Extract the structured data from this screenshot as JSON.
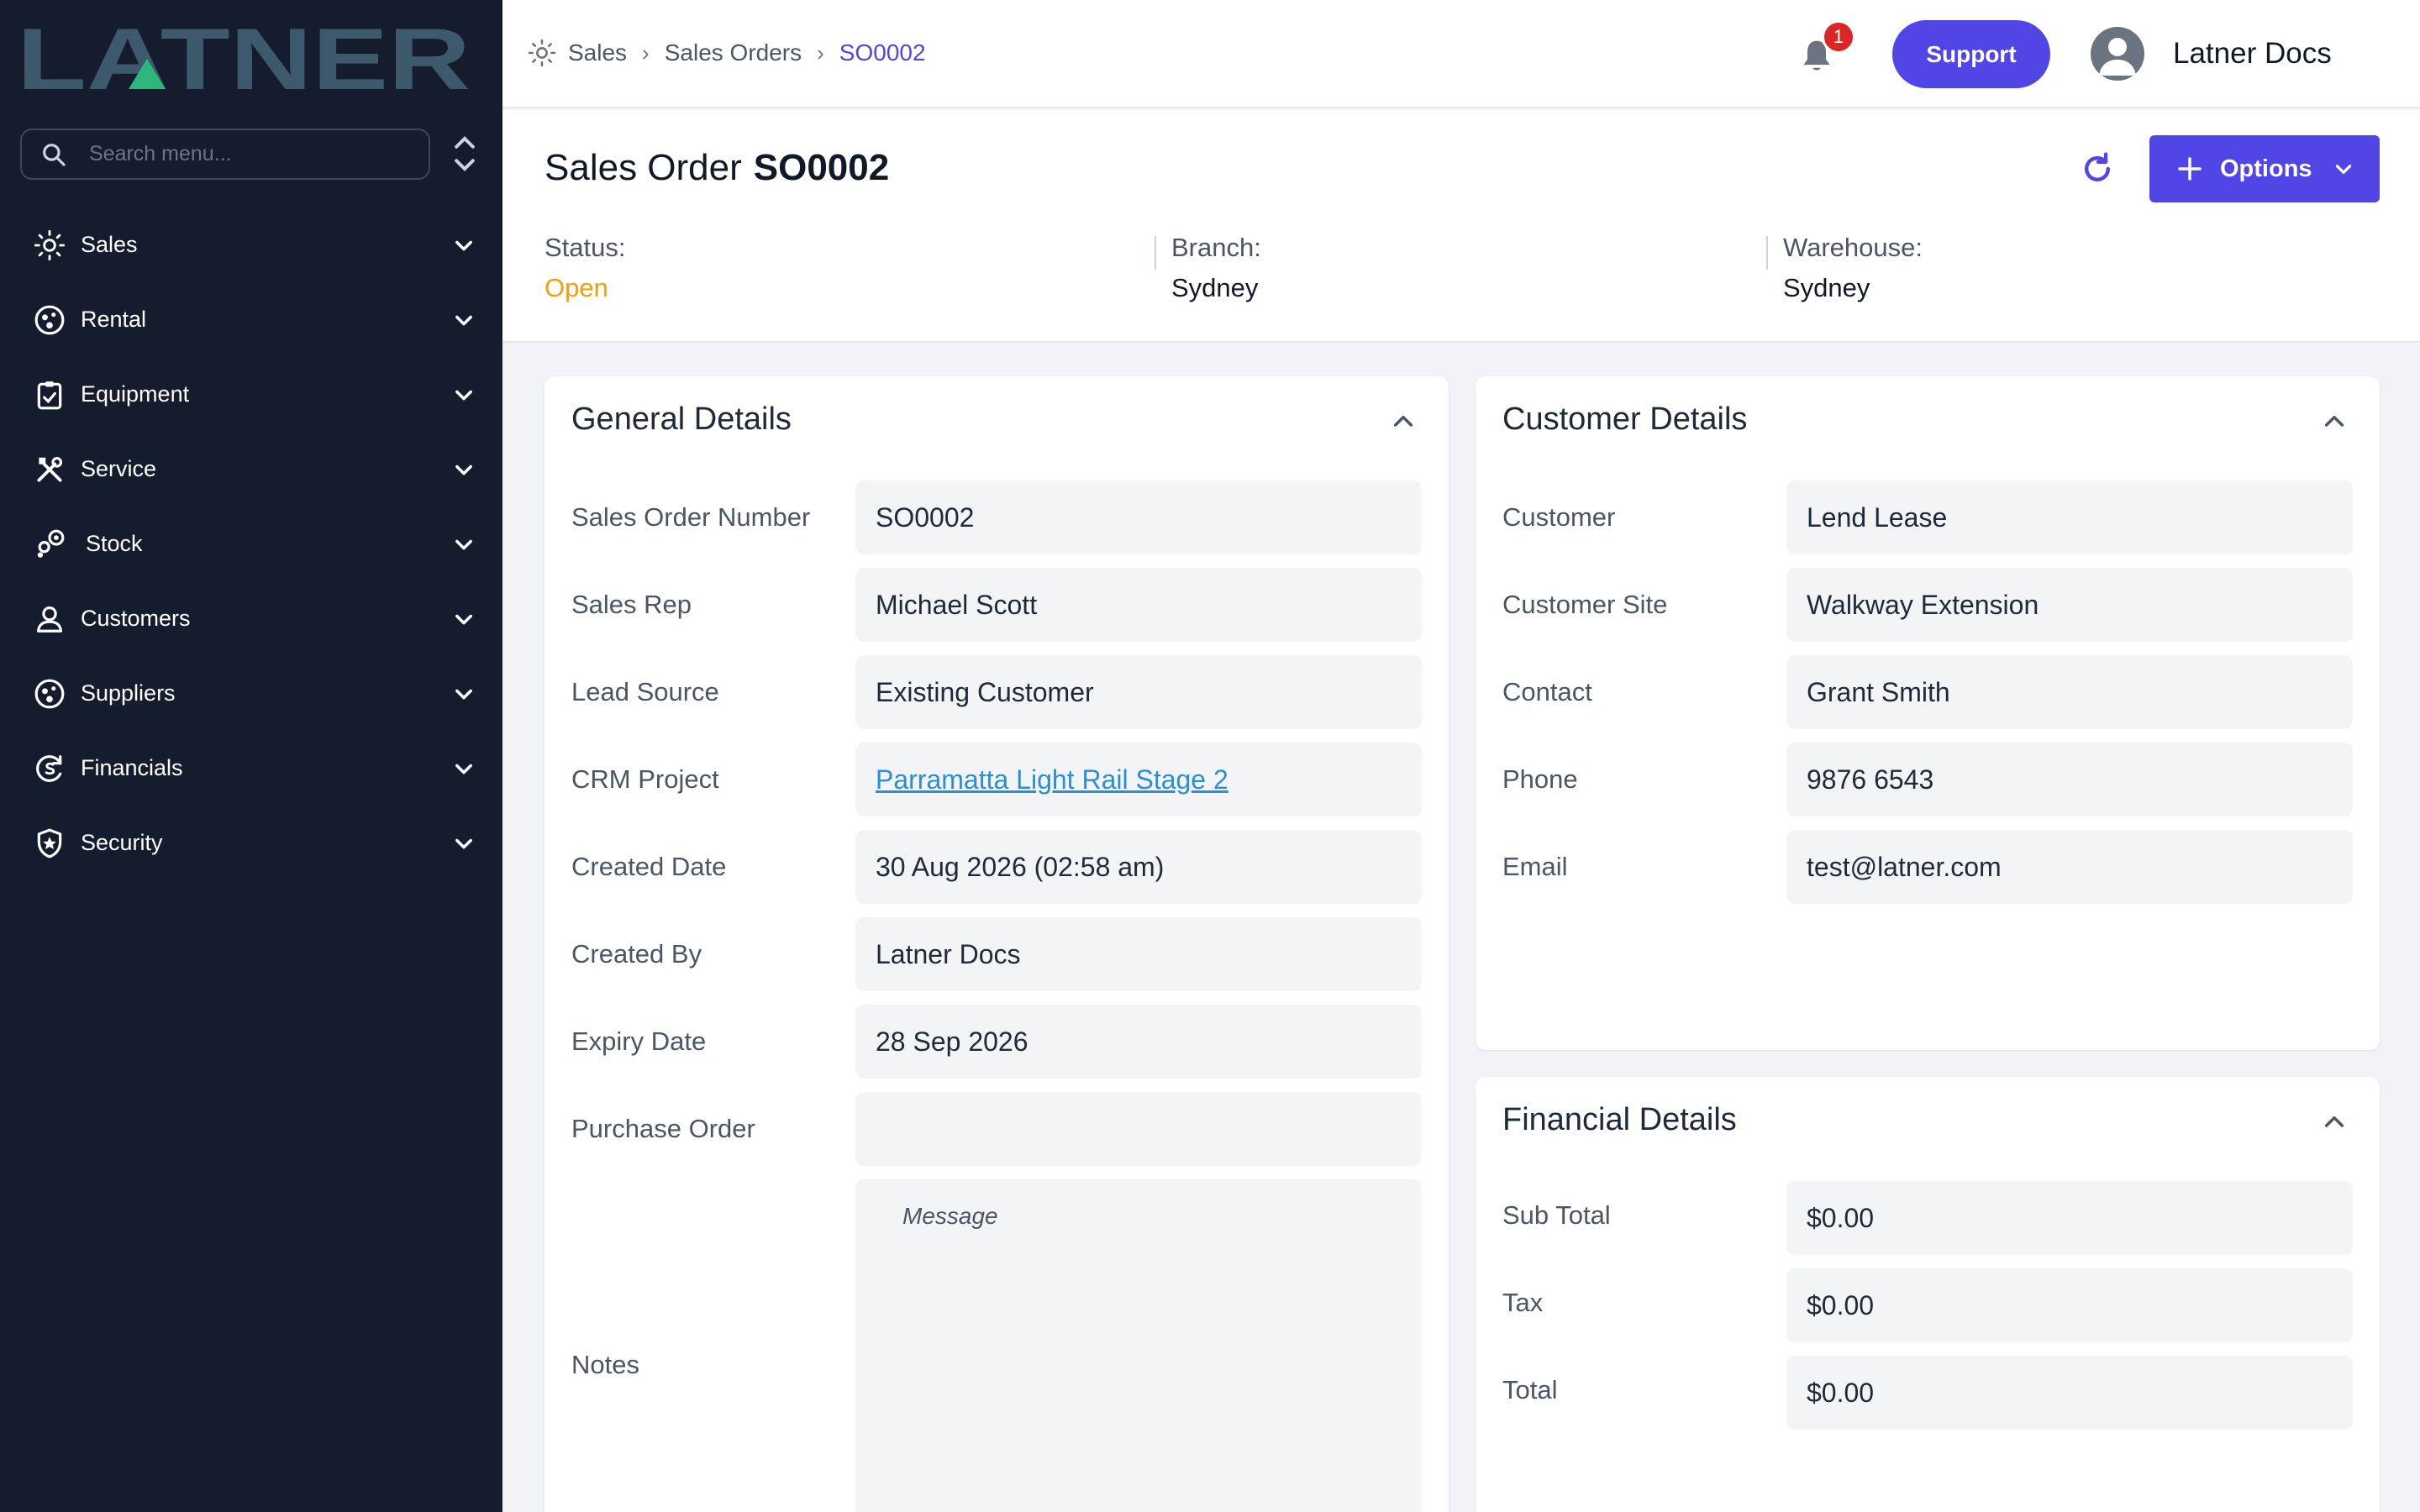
{
  "brand": {
    "logo_text": "LATNER",
    "logo_color": "#3d5a6c",
    "accent_triangle_color": "#2db87a"
  },
  "sidebar": {
    "search_placeholder": "Search menu...",
    "items": [
      {
        "label": "Sales",
        "icon": "sales-icon"
      },
      {
        "label": "Rental",
        "icon": "rental-icon"
      },
      {
        "label": "Equipment",
        "icon": "equipment-icon"
      },
      {
        "label": "Service",
        "icon": "service-icon"
      },
      {
        "label": "Stock",
        "icon": "stock-icon"
      },
      {
        "label": "Customers",
        "icon": "customers-icon"
      },
      {
        "label": "Suppliers",
        "icon": "suppliers-icon"
      },
      {
        "label": "Financials",
        "icon": "financials-icon"
      },
      {
        "label": "Security",
        "icon": "security-icon"
      }
    ]
  },
  "topbar": {
    "breadcrumb": [
      "Sales",
      "Sales Orders",
      "SO0002"
    ],
    "notification_count": "1",
    "support_label": "Support",
    "user_name": "Latner Docs"
  },
  "header": {
    "title_prefix": "Sales Order",
    "title_id": "SO0002",
    "options_label": "Options",
    "status_label": "Status:",
    "status_value": "Open",
    "status_color": "#f59e0b",
    "branch_label": "Branch:",
    "branch_value": "Sydney",
    "warehouse_label": "Warehouse:",
    "warehouse_value": "Sydney"
  },
  "general": {
    "title": "General Details",
    "fields": [
      {
        "label": "Sales Order Number",
        "value": "SO0002"
      },
      {
        "label": "Sales Rep",
        "value": "Michael Scott"
      },
      {
        "label": "Lead Source",
        "value": "Existing Customer"
      },
      {
        "label": "CRM Project",
        "value": "Parramatta Light Rail Stage 2"
      },
      {
        "label": "Created Date",
        "value": "30 Aug 2026 (02:58 am)"
      },
      {
        "label": "Created By",
        "value": "Latner Docs"
      },
      {
        "label": "Expiry Date",
        "value": "28 Sep 2026"
      },
      {
        "label": "Purchase Order",
        "value": ""
      }
    ],
    "notes_label": "Notes",
    "notes_placeholder": "Message"
  },
  "customer": {
    "title": "Customer Details",
    "fields": [
      {
        "label": "Customer",
        "value": "Lend Lease"
      },
      {
        "label": "Customer Site",
        "value": "Walkway Extension"
      },
      {
        "label": "Contact",
        "value": "Grant Smith"
      },
      {
        "label": "Phone",
        "value": "9876 6543"
      },
      {
        "label": "Email",
        "value": "test@latner.com"
      }
    ]
  },
  "financial": {
    "title": "Financial Details",
    "fields": [
      {
        "label": "Sub Total",
        "value": "$0.00"
      },
      {
        "label": "Tax",
        "value": "$0.00"
      },
      {
        "label": "Total",
        "value": "$0.00"
      }
    ]
  }
}
